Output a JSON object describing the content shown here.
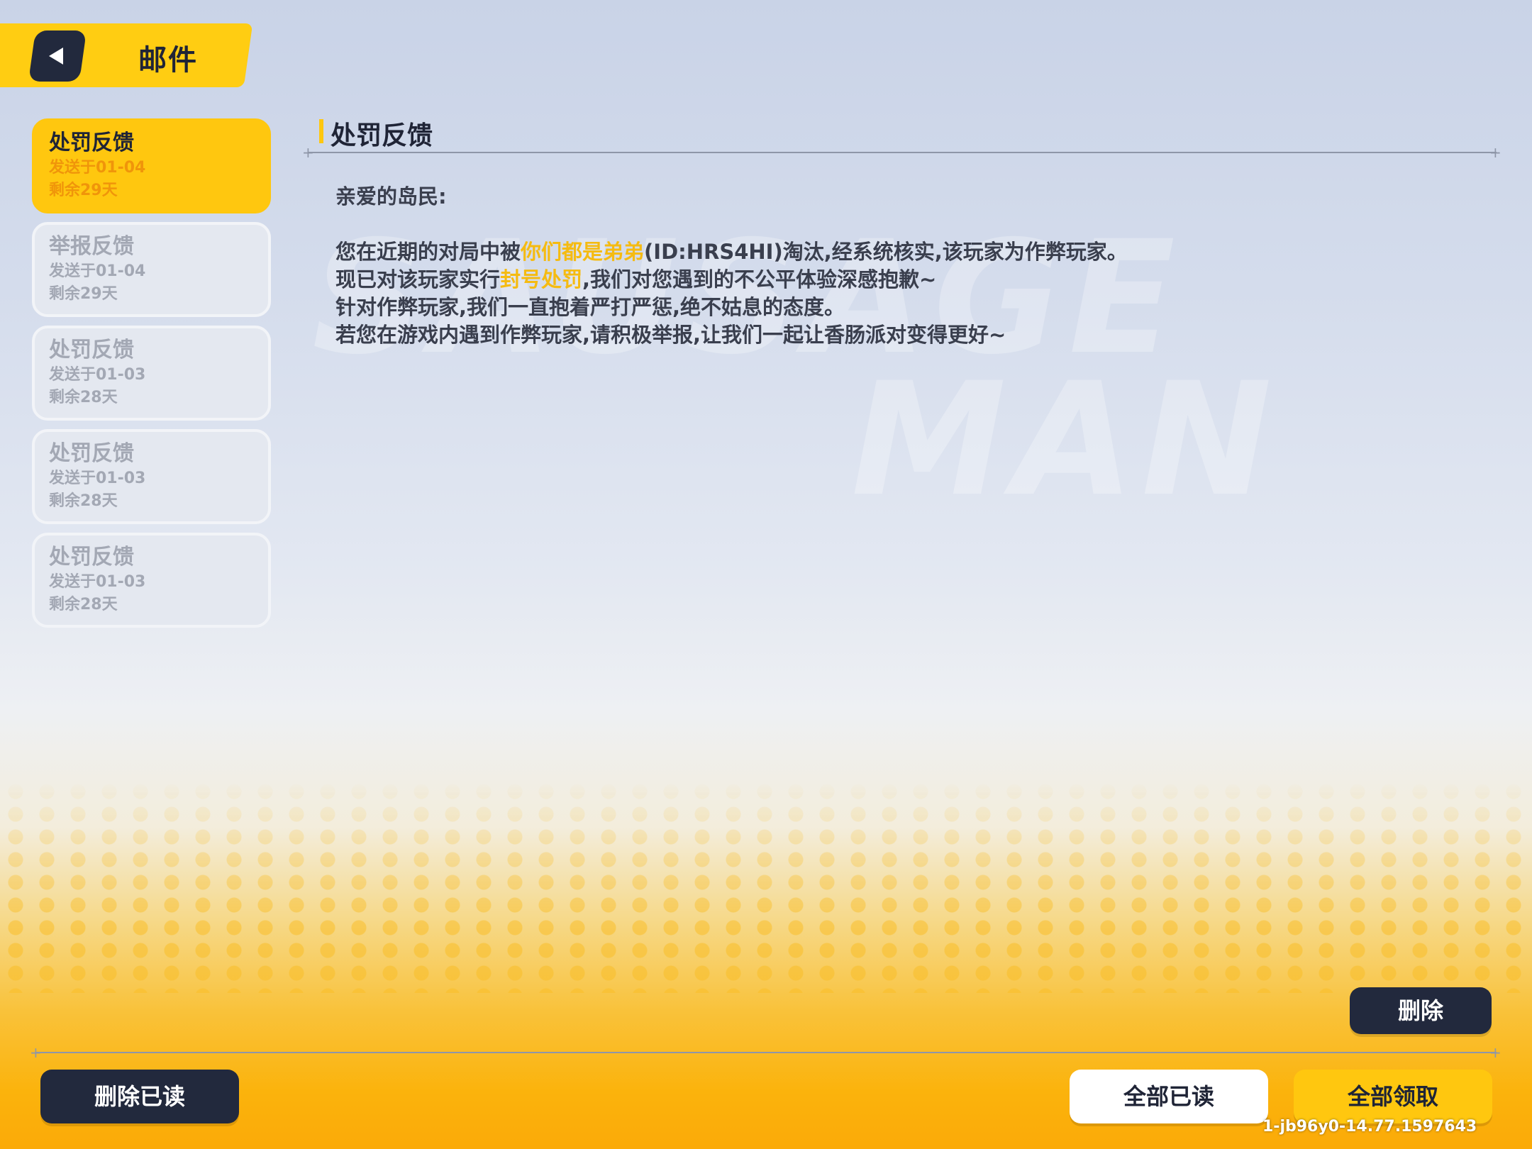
{
  "header": {
    "title": "邮件"
  },
  "mails": [
    {
      "title": "处罚反馈",
      "sent": "发送于01-04",
      "remaining": "剩余29天",
      "active": true
    },
    {
      "title": "举报反馈",
      "sent": "发送于01-04",
      "remaining": "剩余29天",
      "active": false
    },
    {
      "title": "处罚反馈",
      "sent": "发送于01-03",
      "remaining": "剩余28天",
      "active": false
    },
    {
      "title": "处罚反馈",
      "sent": "发送于01-03",
      "remaining": "剩余28天",
      "active": false
    },
    {
      "title": "处罚反馈",
      "sent": "发送于01-03",
      "remaining": "剩余28天",
      "active": false
    }
  ],
  "detail": {
    "title": "处罚反馈",
    "greeting": "亲爱的岛民:",
    "line1_pre": "您在近期的对局中被",
    "line1_name": "你们都是弟弟",
    "line1_post": "(ID:HRS4HI)淘汰,经系统核实,该玩家为作弊玩家。",
    "line2_pre": "现已对该玩家实行",
    "line2_hl": "封号处罚",
    "line2_post": ",我们对您遇到的不公平体验深感抱歉~",
    "line3": "针对作弊玩家,我们一直抱着严打严惩,绝不姑息的态度。",
    "line4": "若您在游戏内遇到作弊玩家,请积极举报,让我们一起让香肠派对变得更好~"
  },
  "buttons": {
    "delete": "删除",
    "delete_read": "删除已读",
    "mark_all_read": "全部已读",
    "claim_all": "全部领取"
  },
  "version": "1-jb96y0-14.77.1597643",
  "colors": {
    "accent_yellow": "#ffc70f",
    "dark_navy": "#22293d",
    "highlight_text": "#f5bb12"
  }
}
